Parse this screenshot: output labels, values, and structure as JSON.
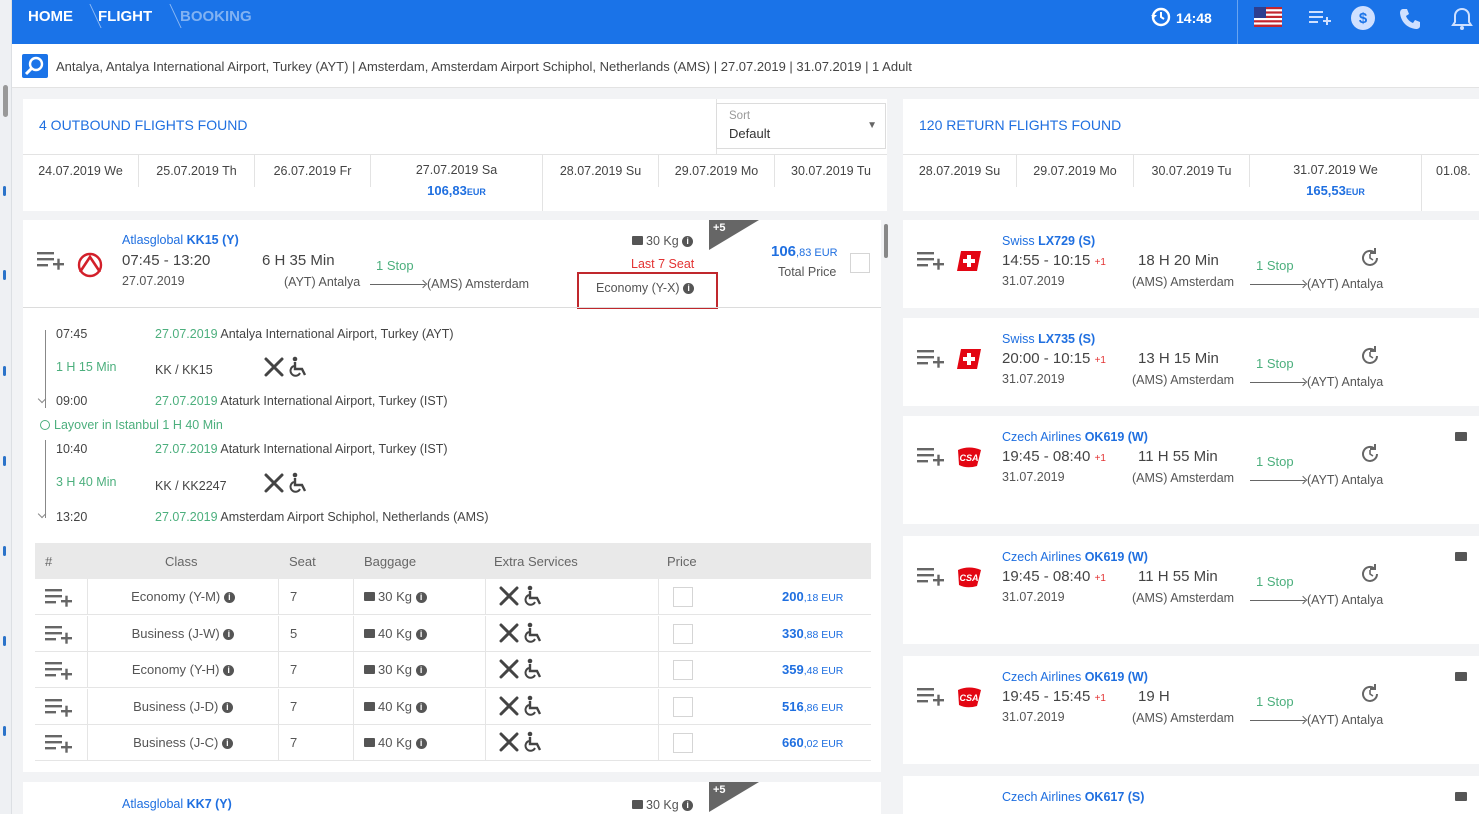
{
  "nav": {
    "home": "HOME",
    "flight": "FLIGHT",
    "booking": "BOOKING",
    "time": "14:48"
  },
  "search": {
    "summary": "Antalya, Antalya International Airport, Turkey (AYT) | Amsterdam, Amsterdam Airport Schiphol, Netherlands (AMS) | 27.07.2019 | 31.07.2019 | 1 Adult"
  },
  "outbound": {
    "title": "4 OUTBOUND FLIGHTS FOUND",
    "sort_label": "Sort",
    "sort_value": "Default",
    "dates": [
      "24.07.2019 We",
      "25.07.2019 Th",
      "26.07.2019 Fr",
      "27.07.2019 Sa",
      "28.07.2019 Su",
      "29.07.2019 Mo",
      "30.07.2019 Tu"
    ],
    "selected_price": "106,83",
    "selected_currency": "EUR"
  },
  "return": {
    "title": "120 RETURN FLIGHTS FOUND",
    "dates": [
      "28.07.2019 Su",
      "29.07.2019 Mo",
      "30.07.2019 Tu",
      "31.07.2019 We",
      "01.08."
    ],
    "selected_price": "165,53",
    "selected_currency": "EUR"
  },
  "flight1": {
    "airline": "Atlasglobal",
    "code": "KK15 (Y)",
    "times": "07:45 - 13:20",
    "date": "27.07.2019",
    "duration": "6 H 35 Min",
    "stops": "1 Stop",
    "from": "(AYT) Antalya",
    "to": "(AMS) Amsterdam",
    "baggage": "30 Kg",
    "seats": "Last 7 Seat",
    "class": "Economy (Y-X)",
    "badge": "+5",
    "price_int": "106",
    "price_dec": ",83 EUR",
    "total_label": "Total Price",
    "legs": [
      {
        "time": "07:45",
        "date": "27.07.2019",
        "airport": "Antalya International Airport, Turkey (AYT)"
      },
      {
        "dur": "1 H 15 Min",
        "code": "KK / KK15"
      },
      {
        "time": "09:00",
        "date": "27.07.2019",
        "airport": "Ataturk International Airport, Turkey (IST)"
      },
      {
        "layover": "Layover in Istanbul 1 H 40 Min"
      },
      {
        "time": "10:40",
        "date": "27.07.2019",
        "airport": "Ataturk International Airport, Turkey (IST)"
      },
      {
        "dur": "3 H 40 Min",
        "code": "KK / KK2247"
      },
      {
        "time": "13:20",
        "date": "27.07.2019",
        "airport": "Amsterdam Airport Schiphol, Netherlands (AMS)"
      }
    ],
    "table_headers": [
      "#",
      "Class",
      "Seat",
      "Baggage",
      "Extra Services",
      "Price"
    ],
    "fares": [
      {
        "class": "Economy (Y-M)",
        "seat": "7",
        "bag": "30 Kg",
        "price": "200",
        "dec": ",18 EUR"
      },
      {
        "class": "Business (J-W)",
        "seat": "5",
        "bag": "40 Kg",
        "price": "330",
        "dec": ",88 EUR"
      },
      {
        "class": "Economy (Y-H)",
        "seat": "7",
        "bag": "30 Kg",
        "price": "359",
        "dec": ",48 EUR"
      },
      {
        "class": "Business (J-D)",
        "seat": "7",
        "bag": "40 Kg",
        "price": "516",
        "dec": ",86 EUR"
      },
      {
        "class": "Business (J-C)",
        "seat": "7",
        "bag": "40 Kg",
        "price": "660",
        "dec": ",02 EUR"
      }
    ]
  },
  "flight2": {
    "airline": "Atlasglobal",
    "code": "KK7 (Y)",
    "baggage": "30 Kg",
    "badge": "+5"
  },
  "returns": [
    {
      "airline": "Swiss",
      "code": "LX729 (S)",
      "times": "14:55 - 10:15",
      "plus": "+1",
      "date": "31.07.2019",
      "duration": "18 H 20 Min",
      "stops": "1 Stop",
      "from": "(AMS) Amsterdam",
      "to": "(AYT) Antalya"
    },
    {
      "airline": "Swiss",
      "code": "LX735 (S)",
      "times": "20:00 - 10:15",
      "plus": "+1",
      "date": "31.07.2019",
      "duration": "13 H 15 Min",
      "stops": "1 Stop",
      "from": "(AMS) Amsterdam",
      "to": "(AYT) Antalya"
    },
    {
      "airline": "Czech Airlines",
      "code": "OK619 (W)",
      "times": "19:45 - 08:40",
      "plus": "+1",
      "date": "31.07.2019",
      "duration": "11 H 55 Min",
      "stops": "1 Stop",
      "from": "(AMS) Amsterdam",
      "to": "(AYT) Antalya"
    },
    {
      "airline": "Czech Airlines",
      "code": "OK619 (W)",
      "times": "19:45 - 08:40",
      "plus": "+1",
      "date": "31.07.2019",
      "duration": "11 H 55 Min",
      "stops": "1 Stop",
      "from": "(AMS) Amsterdam",
      "to": "(AYT) Antalya"
    },
    {
      "airline": "Czech Airlines",
      "code": "OK619 (W)",
      "times": "19:45 - 15:45",
      "plus": "+1",
      "date": "31.07.2019",
      "duration": "19 H",
      "stops": "1 Stop",
      "from": "(AMS) Amsterdam",
      "to": "(AYT) Antalya"
    },
    {
      "airline": "Czech Airlines",
      "code": "OK617 (S)"
    }
  ],
  "colors": {
    "brand": "#1a73e8",
    "link": "#1f6fe0",
    "alert": "#e33333",
    "green": "#4caf7d",
    "highlight": "#c0282d"
  }
}
